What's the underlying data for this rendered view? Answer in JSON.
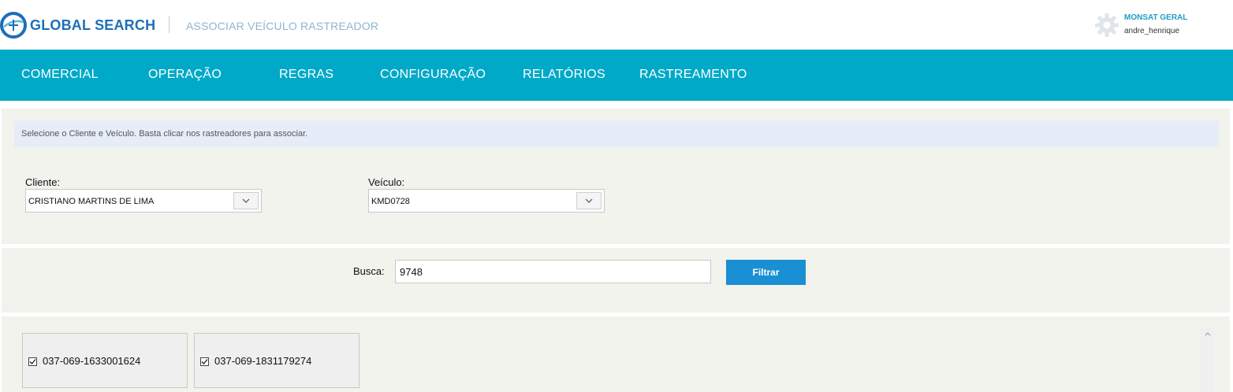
{
  "header": {
    "logo_text": "GLOBAL SEARCH",
    "page_title": "ASSOCIAR VEÍCULO RASTREADOR",
    "user_name": "MONSAT GERAL",
    "user_login": "andre_henrique"
  },
  "nav": {
    "items": [
      {
        "label": "COMERCIAL"
      },
      {
        "label": "OPERAÇÃO"
      },
      {
        "label": "REGRAS"
      },
      {
        "label": "CONFIGURAÇÃO"
      },
      {
        "label": "RELATÓRIOS"
      },
      {
        "label": "RASTREAMENTO"
      }
    ]
  },
  "form": {
    "info": "Selecione o Cliente e Veículo. Basta clicar nos rastreadores para associar.",
    "cliente_label": "Cliente:",
    "cliente_value": "CRISTIANO MARTINS DE LIMA",
    "veiculo_label": "Veículo:",
    "veiculo_value": "KMD0728"
  },
  "search": {
    "label": "Busca:",
    "value": "9748",
    "button": "Filtrar"
  },
  "trackers": [
    {
      "label": "037-069-1633001624",
      "checked": true
    },
    {
      "label": "037-069-1831179274",
      "checked": true
    }
  ],
  "colors": {
    "navbar": "#00a9c7",
    "brand": "#1d6fb8",
    "filter_button": "#1a8fd3",
    "panel_bg": "#f1f3ec",
    "info_bg": "#e6edf8"
  },
  "icons": [
    "logo-icon",
    "gear-icon",
    "chevron-down-icon",
    "checkbox-checked-icon",
    "scroll-up-icon"
  ]
}
